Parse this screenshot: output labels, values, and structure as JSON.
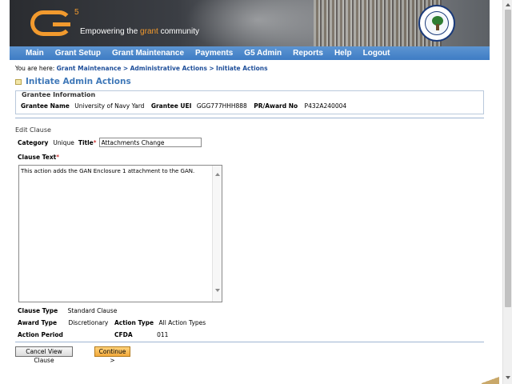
{
  "header": {
    "logo_mark": "G",
    "logo_superscript": "5",
    "tagline_pre": "Empowering the ",
    "tagline_highlight": "grant",
    "tagline_post": " community",
    "seal_alt": "Department of Education seal",
    "brand_color": "#f29a2e",
    "nav_color": "#3e7cc4"
  },
  "nav": {
    "items": [
      "Main",
      "Grant Setup",
      "Grant Maintenance",
      "Payments",
      "G5 Admin",
      "Reports",
      "Help",
      "Logout"
    ]
  },
  "breadcrumb": {
    "prefix": "You are here:",
    "items": [
      "Grant Maintenance",
      "Administrative Actions",
      "Initiate Actions"
    ],
    "separator": ">"
  },
  "page_title": "Initiate Admin Actions",
  "grantee": {
    "legend": "Grantee Information",
    "name_label": "Grantee Name",
    "name_value": "University of Navy Yard",
    "uei_label": "Grantee UEI",
    "uei_value": "GGG777HHH888",
    "award_label": "PR/Award No",
    "award_value": "P432A240004"
  },
  "edit_clause": {
    "heading": "Edit Clause",
    "category_label": "Category",
    "category_value": "Unique",
    "title_label": "Title",
    "title_required": "*",
    "title_value": "Attachments Change",
    "clause_text_label": "Clause Text",
    "clause_text_required": "*",
    "clause_text_value": "This action adds the GAN Enclosure 1 attachment to the GAN."
  },
  "details": {
    "clause_type_label": "Clause Type",
    "clause_type_value": "Standard Clause",
    "award_type_label": "Award Type",
    "award_type_value": "Discretionary",
    "action_type_label": "Action Type",
    "action_type_value": "All Action Types",
    "action_period_label": "Action Period",
    "action_period_value": "",
    "cfda_label": "CFDA",
    "cfda_value": "011"
  },
  "buttons": {
    "cancel": "Cancel View Clause",
    "continue": "Continue >"
  }
}
